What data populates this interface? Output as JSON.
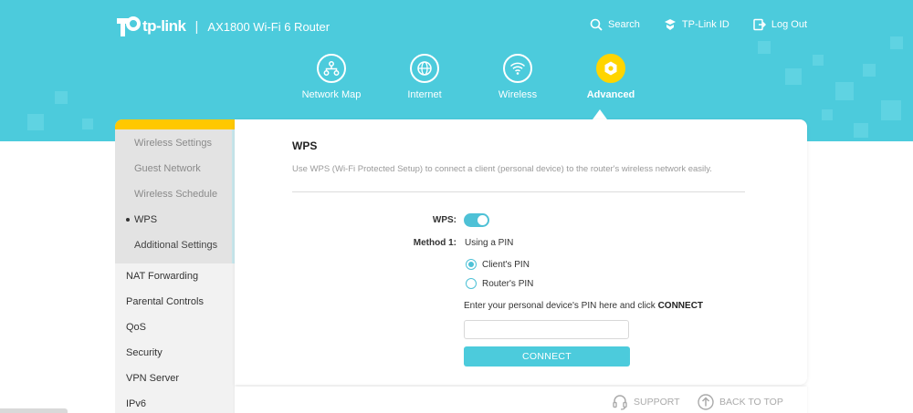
{
  "header": {
    "brand": "tp-link",
    "separator": "|",
    "model": "AX1800 Wi-Fi 6 Router",
    "links": [
      {
        "label": "Search",
        "icon": "search-icon"
      },
      {
        "label": "TP-Link ID",
        "icon": "tplink-id-icon"
      },
      {
        "label": "Log Out",
        "icon": "logout-icon"
      }
    ],
    "colors": {
      "banner": "#4ccbdc",
      "accent": "#ffd500"
    }
  },
  "nav": [
    {
      "label": "Network Map",
      "icon": "network-map-icon"
    },
    {
      "label": "Internet",
      "icon": "globe-icon"
    },
    {
      "label": "Wireless",
      "icon": "wifi-icon"
    },
    {
      "label": "Advanced",
      "icon": "gear-icon",
      "active": true
    }
  ],
  "sidebar": {
    "sub_items": [
      "Wireless Settings",
      "Guest Network",
      "Wireless Schedule",
      "WPS",
      "Additional Settings"
    ],
    "active_sub": "WPS",
    "main_items": [
      "NAT Forwarding",
      "Parental Controls",
      "QoS",
      "Security",
      "VPN Server",
      "IPv6"
    ]
  },
  "content": {
    "title": "WPS",
    "description": "Use WPS (Wi-Fi Protected Setup) to connect a client (personal device) to the router's wireless network easily.",
    "wps_label": "WPS:",
    "wps_enabled": true,
    "method_label": "Method 1:",
    "method_value": "Using a PIN",
    "options": [
      {
        "label": "Client's PIN",
        "checked": true
      },
      {
        "label": "Router's PIN",
        "checked": false
      }
    ],
    "pin_help_prefix": "Enter your personal device's PIN here and click ",
    "pin_help_bold": "CONNECT",
    "pin_value": "",
    "connect_label": "CONNECT"
  },
  "footer": {
    "support": "SUPPORT",
    "back_to_top": "BACK TO TOP"
  }
}
